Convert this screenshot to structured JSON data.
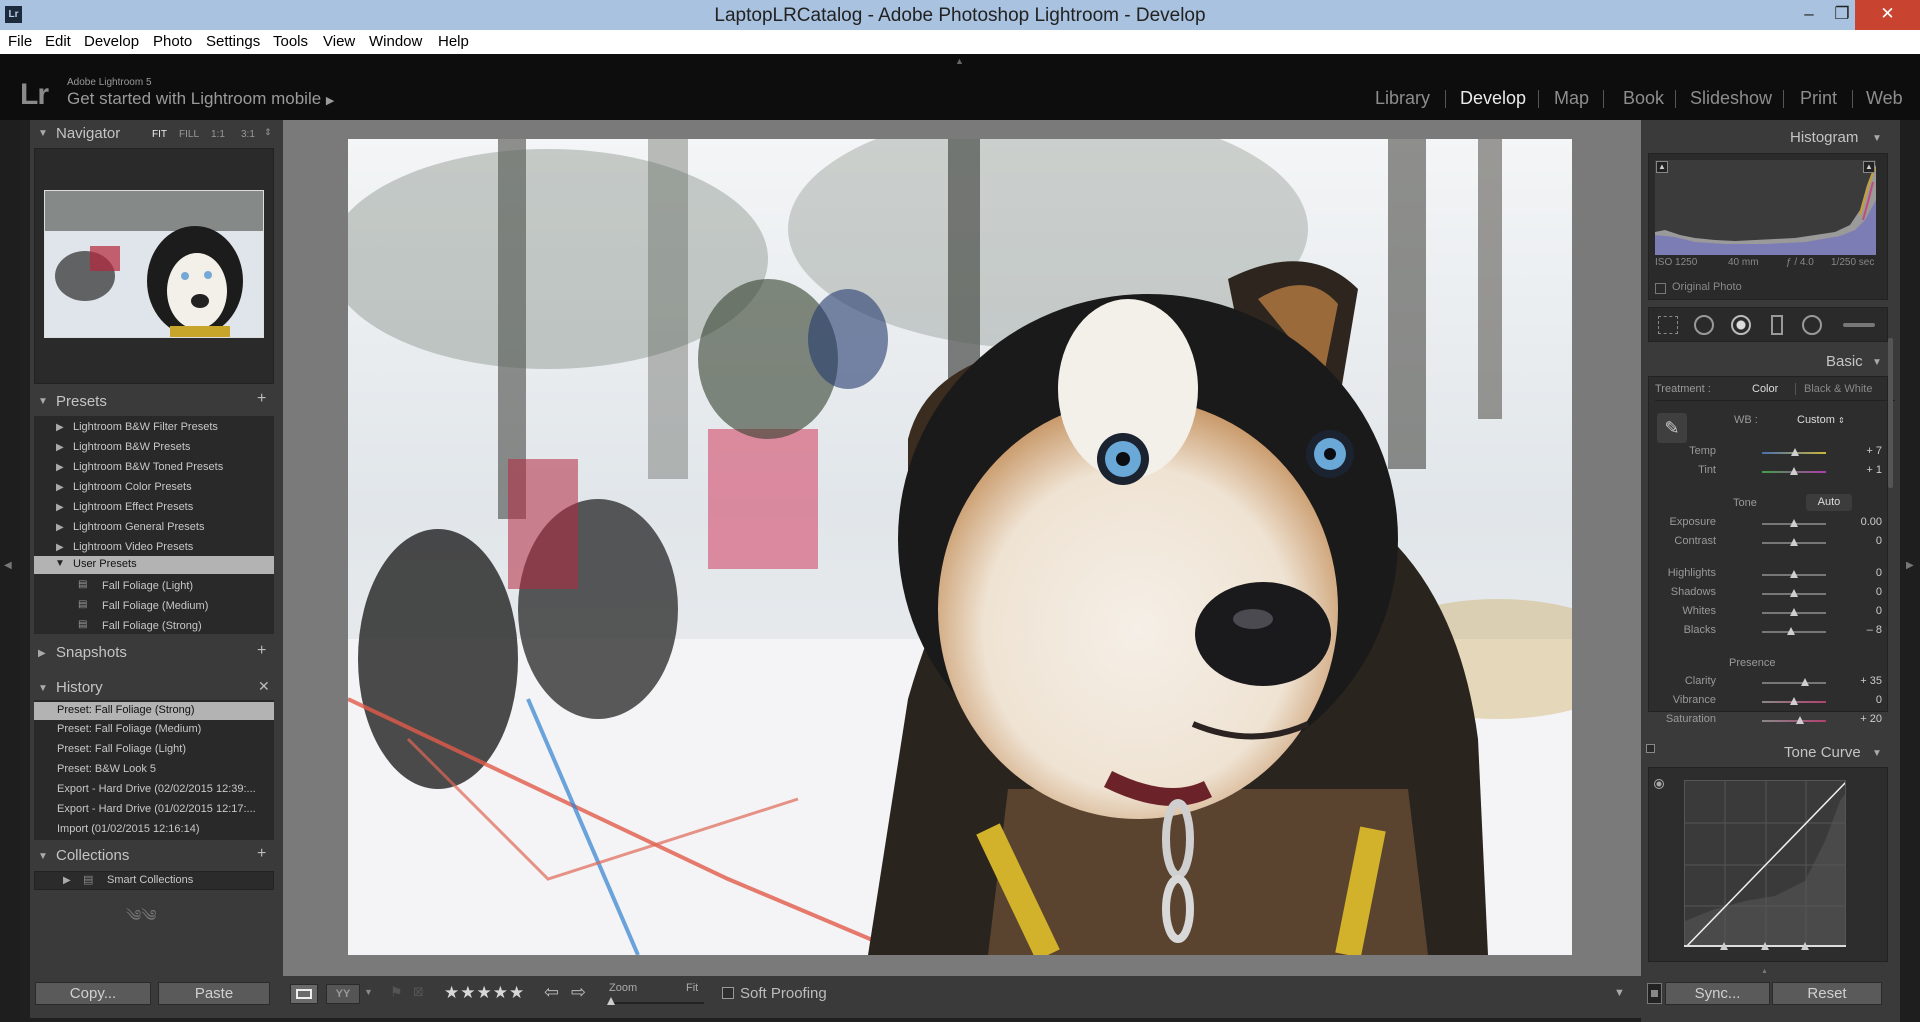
{
  "window": {
    "title": "LaptopLRCatalog - Adobe Photoshop Lightroom - Develop",
    "app_icon": "Lr",
    "controls": {
      "minimize": "–",
      "maximize": "❐",
      "close": "✕"
    }
  },
  "menu": [
    "File",
    "Edit",
    "Develop",
    "Photo",
    "Settings",
    "Tools",
    "View",
    "Window",
    "Help"
  ],
  "identity": {
    "logo": "Lr",
    "version": "Adobe Lightroom 5",
    "tagline": "Get started with Lightroom mobile"
  },
  "modules": [
    "Library",
    "Develop",
    "Map",
    "Book",
    "Slideshow",
    "Print",
    "Web"
  ],
  "active_module": "Develop",
  "navigator": {
    "title": "Navigator",
    "zoom_options": [
      "FIT",
      "FILL",
      "1:1",
      "3:1"
    ]
  },
  "presets": {
    "title": "Presets",
    "folders": [
      "Lightroom B&W Filter Presets",
      "Lightroom B&W Presets",
      "Lightroom B&W Toned Presets",
      "Lightroom Color Presets",
      "Lightroom Effect Presets",
      "Lightroom General Presets",
      "Lightroom Video Presets",
      "User Presets"
    ],
    "user_presets": [
      "Fall Foliage (Light)",
      "Fall Foliage (Medium)",
      "Fall Foliage (Strong)"
    ]
  },
  "snapshots": {
    "title": "Snapshots"
  },
  "history": {
    "title": "History",
    "items": [
      "Preset: Fall Foliage (Strong)",
      "Preset: Fall Foliage (Medium)",
      "Preset: Fall Foliage (Light)",
      "Preset: B&W Look 5",
      "Export - Hard Drive (02/02/2015 12:39:...",
      "Export - Hard Drive (01/02/2015 12:17:...",
      "Import (01/02/2015 12:16:14)"
    ]
  },
  "collections": {
    "title": "Collections",
    "items": [
      "Smart Collections"
    ]
  },
  "left_buttons": {
    "copy": "Copy...",
    "paste": "Paste"
  },
  "histogram": {
    "title": "Histogram",
    "iso": "ISO 1250",
    "focal": "40 mm",
    "aperture": "ƒ / 4.0",
    "shutter": "1/250 sec",
    "original_photo": "Original Photo"
  },
  "basic": {
    "title": "Basic",
    "treatment_label": "Treatment :",
    "treatment_color": "Color",
    "treatment_bw": "Black & White",
    "wb_label": "WB :",
    "wb_value": "Custom",
    "tone_label": "Tone",
    "auto_label": "Auto",
    "presence_label": "Presence",
    "sliders": {
      "temp": {
        "label": "Temp",
        "value": "+ 7",
        "pos": 0.52
      },
      "tint": {
        "label": "Tint",
        "value": "+ 1",
        "pos": 0.5
      },
      "exposure": {
        "label": "Exposure",
        "value": "0.00",
        "pos": 0.5
      },
      "contrast": {
        "label": "Contrast",
        "value": "0",
        "pos": 0.5
      },
      "highlights": {
        "label": "Highlights",
        "value": "0",
        "pos": 0.5
      },
      "shadows": {
        "label": "Shadows",
        "value": "0",
        "pos": 0.5
      },
      "whites": {
        "label": "Whites",
        "value": "0",
        "pos": 0.5
      },
      "blacks": {
        "label": "Blacks",
        "value": "– 8",
        "pos": 0.46
      },
      "clarity": {
        "label": "Clarity",
        "value": "+ 35",
        "pos": 0.67
      },
      "vibrance": {
        "label": "Vibrance",
        "value": "0",
        "pos": 0.5
      },
      "saturation": {
        "label": "Saturation",
        "value": "+ 20",
        "pos": 0.6
      }
    }
  },
  "tone_curve": {
    "title": "Tone Curve"
  },
  "right_buttons": {
    "sync": "Sync...",
    "reset": "Reset"
  },
  "toolbar": {
    "stars": "★★★★★",
    "zoom_label": "Zoom",
    "fit_label": "Fit",
    "soft_proofing": "Soft Proofing"
  }
}
